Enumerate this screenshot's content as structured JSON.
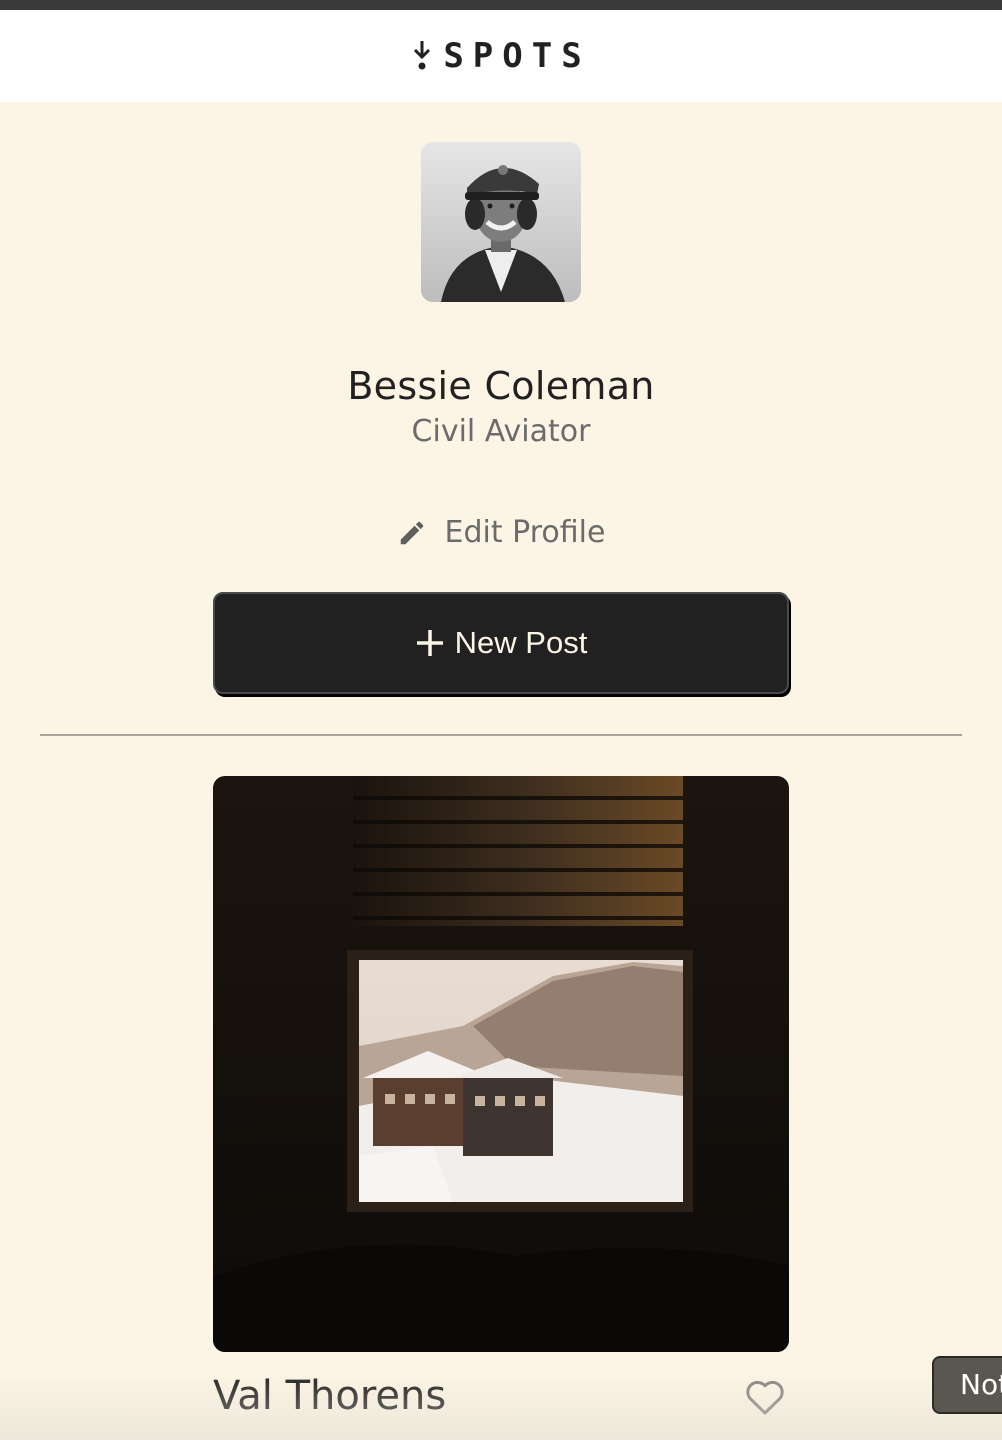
{
  "header": {
    "logo_text": "SPOTS",
    "logo_icon": "down-arrow-dot-icon"
  },
  "profile": {
    "avatar_alt": "avatar",
    "name": "Bessie Coleman",
    "title": "Civil Aviator",
    "edit_label": "Edit Profile",
    "edit_icon": "pencil-icon"
  },
  "actions": {
    "new_post_label": "New Post",
    "new_post_icon": "plus-icon"
  },
  "cards": [
    {
      "title": "Val Thorens",
      "liked": false,
      "like_icon": "heart-outline-icon"
    }
  ],
  "tooltip": {
    "text": "Not"
  },
  "colors": {
    "background": "#fcf5e5",
    "text": "#212121",
    "muted": "#6b6b6b",
    "button": "#212121"
  }
}
